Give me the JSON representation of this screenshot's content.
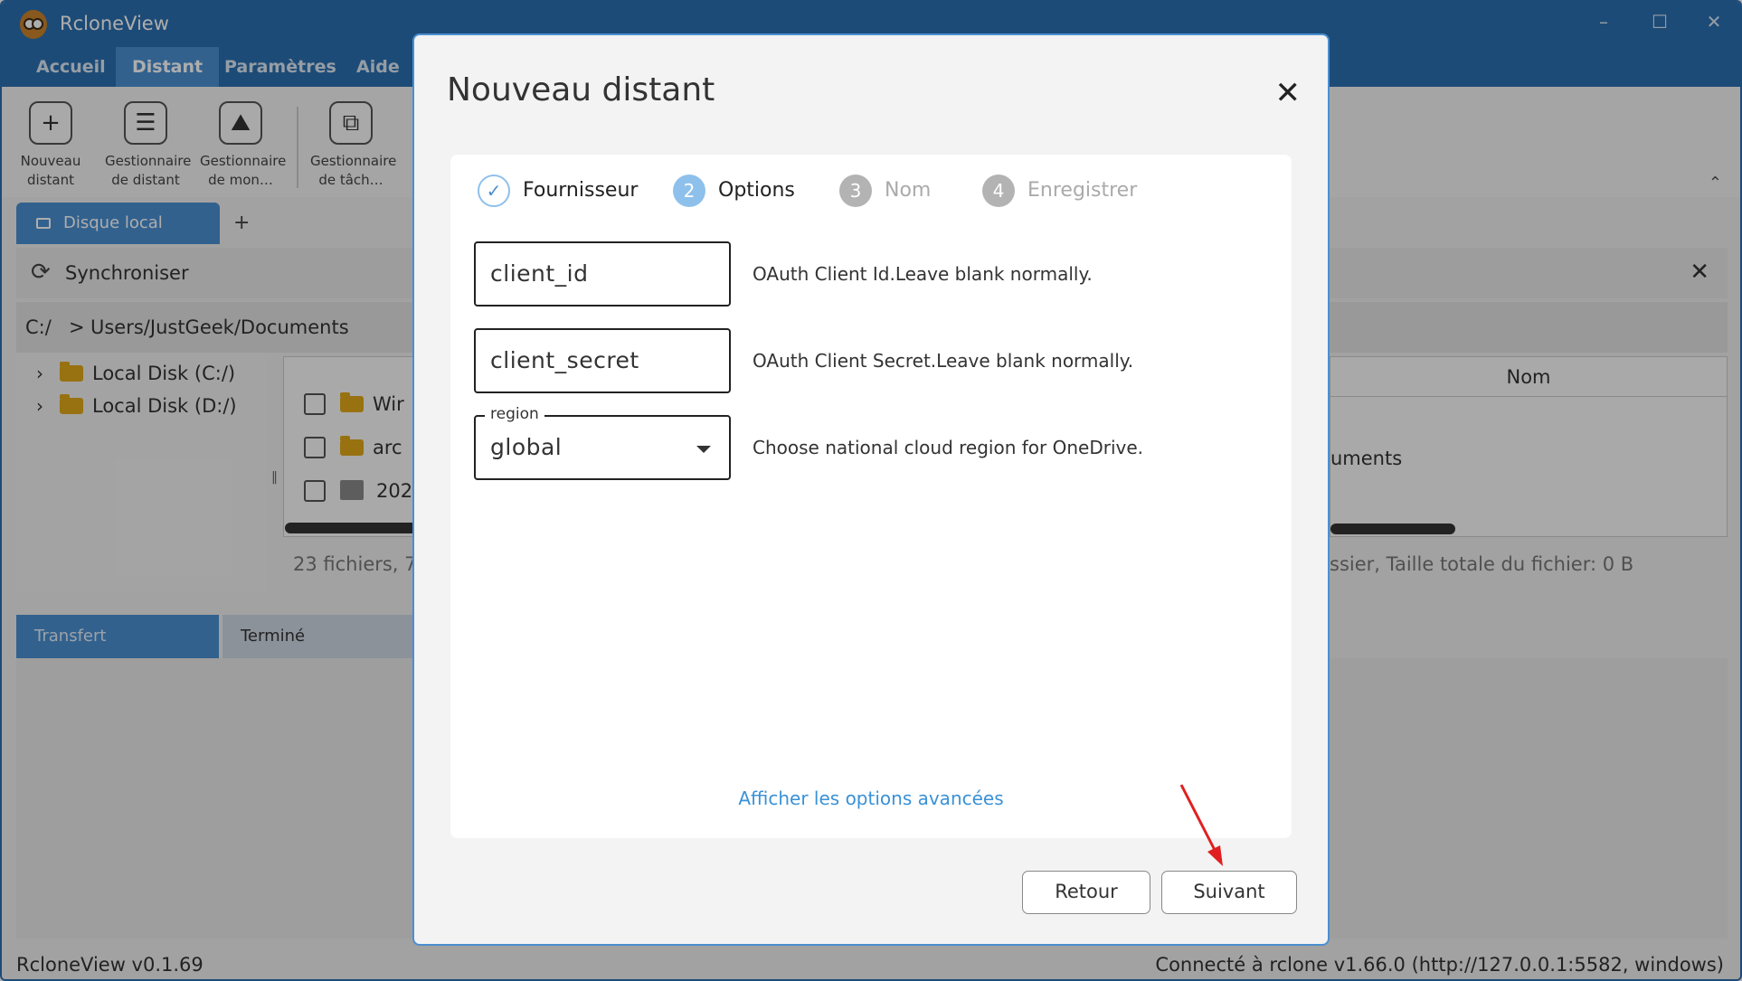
{
  "app": {
    "title": "RcloneView",
    "menu": [
      "Accueil",
      "Distant",
      "Paramètres",
      "Aide"
    ],
    "window_controls": {
      "minimize": "–",
      "maximize": "☐",
      "close": "✕"
    },
    "toolbar": [
      {
        "icon": "plus-icon",
        "glyph": "+",
        "label": "Nouveau distant"
      },
      {
        "icon": "server-list-icon",
        "glyph": "☰",
        "label": "Gestionnaire de distant"
      },
      {
        "icon": "mount-icon",
        "glyph": "⛰",
        "label": "Gestionnaire de mon…"
      },
      {
        "icon": "task-manager-icon",
        "glyph": "⧉",
        "label": "Gestionnaire de tâch…"
      }
    ],
    "local_tab": {
      "label": "Disque local",
      "add": "+"
    },
    "sync": {
      "label": "Synchroniser",
      "close": "✕"
    },
    "path": {
      "drive": "C:/",
      "sep": ">",
      "folder": "Users/JustGeek/Documents"
    },
    "tree": [
      {
        "label": "Local Disk (C:/)"
      },
      {
        "label": "Local Disk (D:/)"
      }
    ],
    "files": [
      {
        "name": "Wir",
        "type": "folder"
      },
      {
        "name": "arc",
        "type": "folder"
      },
      {
        "name": "202",
        "type": "image"
      }
    ],
    "status_left": "23 fichiers, 7",
    "right_pane": {
      "header": "Nom",
      "text": "uments",
      "status": "ssier, Taille totale du fichier: 0 B"
    },
    "bottom_tabs": [
      "Transfert",
      "Terminé"
    ],
    "statusbar": {
      "version": "RcloneView v0.1.69",
      "connection": "Connecté à rclone v1.66.0 (http://127.0.0.1:5582, windows)"
    }
  },
  "dialog": {
    "title": "Nouveau distant",
    "close": "✕",
    "steps": [
      {
        "num": "✓",
        "label": "Fournisseur",
        "state": "done"
      },
      {
        "num": "2",
        "label": "Options",
        "state": "current"
      },
      {
        "num": "3",
        "label": "Nom",
        "state": "todo"
      },
      {
        "num": "4",
        "label": "Enregistrer",
        "state": "todo"
      }
    ],
    "fields": [
      {
        "value": "client_id",
        "description": "OAuth Client Id.Leave blank normally."
      },
      {
        "value": "client_secret",
        "description": "OAuth Client Secret.Leave blank normally."
      },
      {
        "legend": "region",
        "value": "global",
        "description": "Choose national cloud region for OneDrive."
      }
    ],
    "advanced_link": "Afficher les options avancées",
    "buttons": {
      "back": "Retour",
      "next": "Suivant"
    }
  },
  "colors": {
    "titlebar": "#2c6fb0",
    "active_tab": "#4b8fd1",
    "link": "#3a91d6",
    "annotation_arrow": "#e02020"
  }
}
